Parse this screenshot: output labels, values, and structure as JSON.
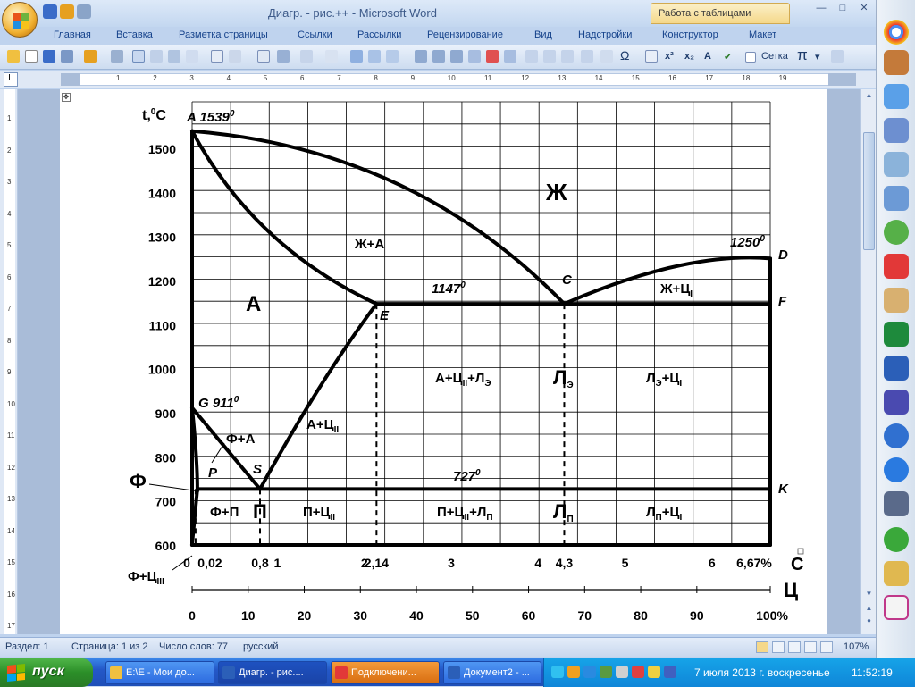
{
  "window": {
    "title": "Диагр. - рис.++ - Microsoft Word",
    "context_tab": "Работа с таблицами",
    "minimize": "—",
    "maximize": "□",
    "close": "✕",
    "help": "?"
  },
  "ribbon": {
    "tabs": [
      "Главная",
      "Вставка",
      "Разметка страницы",
      "Ссылки",
      "Рассылки",
      "Рецензирование",
      "Вид",
      "Надстройки",
      "Конструктор",
      "Макет"
    ]
  },
  "toolbar": {
    "grid_label": "Сетка",
    "pi_label": "π"
  },
  "ruler": {
    "tab_selector": "L",
    "numbers": [
      "1",
      "2",
      "3",
      "4",
      "5",
      "6",
      "7",
      "8",
      "9",
      "10",
      "11",
      "12",
      "13",
      "14",
      "15",
      "16",
      "17",
      "18",
      "19"
    ]
  },
  "vertical_ruler": {
    "numbers": [
      "1",
      "2",
      "3",
      "4",
      "5",
      "6",
      "7",
      "8",
      "9",
      "10",
      "11",
      "12",
      "13",
      "14",
      "15",
      "16",
      "17"
    ]
  },
  "statusbar": {
    "section": "Раздел: 1",
    "page": "Страница: 1 из 2",
    "words": "Число слов: 77",
    "language": "русский",
    "zoom": "107%"
  },
  "taskbar": {
    "start": "пуск",
    "tasks": [
      {
        "label": "E:\\E - Мои до..."
      },
      {
        "label": "Диагр. - рис...."
      },
      {
        "label": "Подключени..."
      },
      {
        "label": "Документ2 - ..."
      }
    ],
    "date": "7 июля 2013 г. воскресенье",
    "time": "11:52:19"
  },
  "diagram": {
    "axis_t_label_main": "t,",
    "axis_t_label_sup": "0",
    "axis_t_label_end": "C",
    "t_ticks": [
      {
        "t": 1500,
        "label": "1500"
      },
      {
        "t": 1400,
        "label": "1400"
      },
      {
        "t": 1300,
        "label": "1300"
      },
      {
        "t": 1200,
        "label": "1200"
      },
      {
        "t": 1100,
        "label": "1100"
      },
      {
        "t": 1000,
        "label": "1000"
      },
      {
        "t": 900,
        "label": "900"
      },
      {
        "t": 800,
        "label": "800"
      },
      {
        "t": 700,
        "label": "700"
      },
      {
        "t": 600,
        "label": "600"
      }
    ],
    "c_ticks": [
      {
        "c": 0,
        "label": "0"
      },
      {
        "c": 0.02,
        "label": "0,02"
      },
      {
        "c": 0.8,
        "label": "0,8"
      },
      {
        "c": 1,
        "label": "1"
      },
      {
        "c": 2,
        "label": "2"
      },
      {
        "c": 2.14,
        "label": "2,14"
      },
      {
        "c": 3,
        "label": "3"
      },
      {
        "c": 4,
        "label": "4"
      },
      {
        "c": 4.3,
        "label": "4,3"
      },
      {
        "c": 5,
        "label": "5"
      },
      {
        "c": 6,
        "label": "6"
      },
      {
        "c": 6.67,
        "label": "6,67%"
      }
    ],
    "c_axis_letter": "C",
    "cementite_axis_letter": "Ц",
    "cementite_ticks": [
      "0",
      "10",
      "20",
      "30",
      "40",
      "50",
      "60",
      "70",
      "80",
      "90",
      "100%"
    ],
    "points": {
      "A": "A 1539",
      "A_sup": "0",
      "D_temp": "1250",
      "D_sup": "0",
      "D": "D",
      "C": "C",
      "E": "E",
      "F": "F",
      "G": "G 911",
      "G_sup": "0",
      "P": "P",
      "S": "S",
      "K": "K",
      "eutectic_temp": "1147",
      "eutectic_sup": "0",
      "eutectoid_temp": "727",
      "eutectoid_sup": "0"
    },
    "regions": {
      "liquid": "Ж",
      "liquid_austenite": "Ж+А",
      "liquid_cementite": "Ж+Ц",
      "liquid_cementite_sub": "I",
      "austenite": "А",
      "austenite_cem2": "А+Ц",
      "austenite_cem2_sub": "II",
      "austenite_cem2_ledeb": "А+Ц",
      "austenite_cem2_ledeb_sub": "II",
      "austenite_cem2_ledeb_tail": "+Л",
      "austenite_cem2_ledeb_sub2": "Э",
      "ledeburite_e": "Л",
      "ledeburite_e_sub": "Э",
      "ledeb_e_cem1": "Л",
      "ledeb_e_cem1_sub": "Э",
      "ledeb_e_cem1_tail": "+Ц",
      "ledeb_e_cem1_sub2": "I",
      "ferrite_austenite": "Ф+А",
      "ferrite": "Ф",
      "ferrite_pearlite": "Ф+П",
      "pearlite": "П",
      "pearlite_cem2": "П+Ц",
      "pearlite_cem2_sub": "II",
      "pearlite_cem2_ledeb": "П+Ц",
      "pearlite_cem2_ledeb_sub": "II",
      "pearlite_cem2_ledeb_tail": "+Л",
      "pearlite_cem2_ledeb_sub2": "П",
      "ledeburite_p": "Л",
      "ledeburite_p_sub": "П",
      "ledeb_p_cem1": "Л",
      "ledeb_p_cem1_sub": "П",
      "ledeb_p_cem1_tail": "+Ц",
      "ledeb_p_cem1_sub2": "I",
      "ferrite_cem3": "Ф+Ц",
      "ferrite_cem3_sub": "III"
    }
  }
}
